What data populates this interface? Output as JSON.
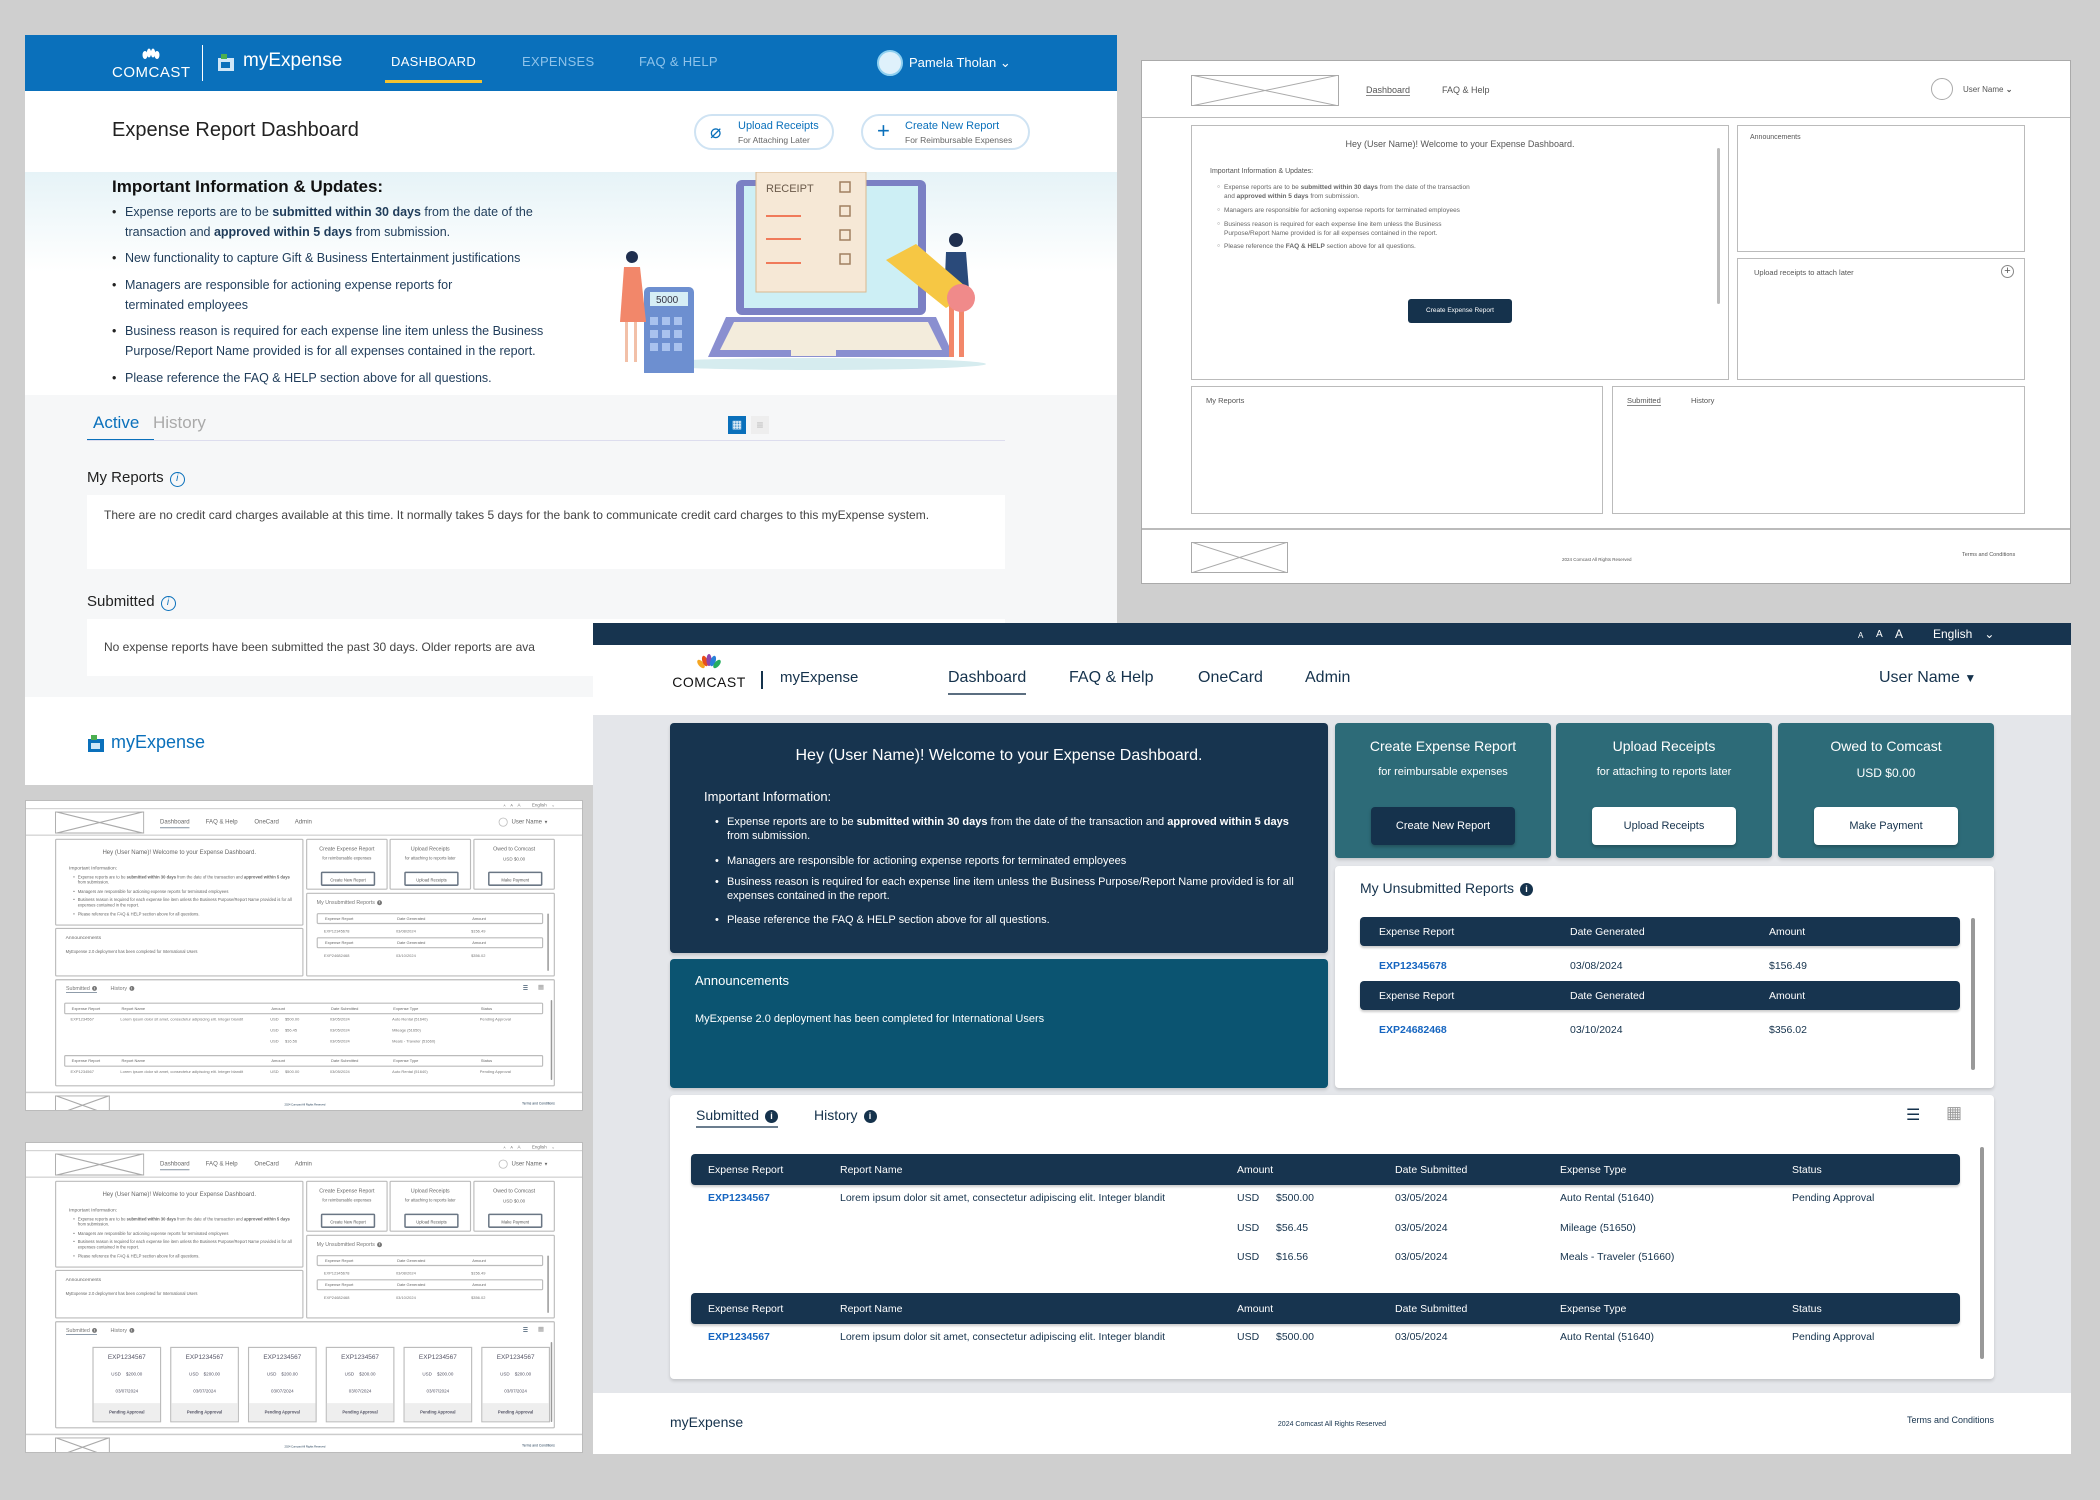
{
  "v1": {
    "header": {
      "brand": "COMCAST",
      "app": "myExpense",
      "nav": [
        "DASHBOARD",
        "EXPENSES",
        "FAQ & HELP"
      ],
      "user": "Pamela Tholan"
    },
    "title": "Expense Report Dashboard",
    "actions": [
      {
        "label": "Upload Receipts",
        "sub": "For Attaching Later"
      },
      {
        "label": "Create New Report",
        "sub": "For Reimbursable Expenses"
      }
    ],
    "info": {
      "heading": "Important Information & Updates:",
      "items": [
        [
          "Expense reports are to be ",
          "submitted within 30 days",
          " from the date of the transaction and ",
          "approved within 5 days",
          " from submission."
        ],
        [
          "New functionality to capture Gift & Business Entertainment justifications"
        ],
        [
          "Managers are responsible for actioning expense reports for terminated employees"
        ],
        [
          "Business reason is required for each expense line item unless the Business Purpose/Report Name provided is for all expenses contained in the report."
        ],
        [
          "Please reference the FAQ & HELP section above for all questions."
        ]
      ]
    },
    "illustration": {
      "receipt_label": "RECEIPT",
      "calc_display": "5000"
    },
    "tabs": [
      "Active",
      "History"
    ],
    "my_reports": {
      "title": "My Reports",
      "message": "There are no credit card charges available at this time. It normally takes 5 days for the bank to communicate credit card charges to this myExpense system."
    },
    "submitted": {
      "title": "Submitted",
      "message": "No expense reports have been submitted the past 30 days. Older reports are ava"
    },
    "footer_app": "myExpense"
  },
  "wireframe_v1": {
    "nav": [
      "Dashboard",
      "FAQ & Help"
    ],
    "user": "User Name",
    "welcome": "Hey (User Name)!  Welcome to your Expense Dashboard.",
    "info_heading": "Important Information & Updates:",
    "items": [
      [
        "Expense reports are to be ",
        "submitted within 30 days",
        " from the date of the transaction and ",
        "approved within 5 days",
        " from submission."
      ],
      [
        "Managers are responsible for actioning expense reports for terminated employees"
      ],
      [
        "Business reason is required for each expense line item unless the Business Purpose/Report Name provided is for all expenses contained in the report."
      ],
      [
        "Please reference the ",
        "FAQ & HELP",
        " section above for all questions."
      ]
    ],
    "button": "Create Expense Report",
    "announcements": "Announcements",
    "upload": "Upload receipts to attach later",
    "my_reports": "My Reports",
    "tabs": [
      "Submitted",
      "History"
    ],
    "copyright": "2024 Comcast All Rights Reserved",
    "terms": "Terms and Conditions"
  },
  "v2": {
    "top_bar": {
      "font_sizes": [
        "A",
        "A",
        "A"
      ],
      "language": "English"
    },
    "header": {
      "brand": "COMCAST",
      "app": "myExpense",
      "nav": [
        "Dashboard",
        "FAQ & Help",
        "OneCard",
        "Admin"
      ],
      "user": "User Name"
    },
    "welcome": {
      "title": "Hey (User Name)!  Welcome to your Expense Dashboard.",
      "info_heading": "Important Information:",
      "items": [
        [
          "Expense reports are to be ",
          "submitted within 30 days",
          " from the date of the transaction and ",
          "approved within 5 days",
          " from submission."
        ],
        [
          "Managers are responsible for actioning expense reports for terminated employees"
        ],
        [
          "Business reason is required for each expense line item unless the Business Purpose/Report Name provided is for all expenses contained in the report."
        ],
        [
          "Please reference the FAQ & HELP section above for all questions."
        ]
      ]
    },
    "tiles": [
      {
        "title": "Create Expense Report",
        "sub": "for reimbursable expenses",
        "button": "Create New Report"
      },
      {
        "title": "Upload Receipts",
        "sub": "for attaching to reports later",
        "button": "Upload Receipts"
      },
      {
        "title": "Owed to Comcast",
        "sub": "USD $0.00",
        "button": "Make Payment"
      }
    ],
    "announcements": {
      "title": "Announcements",
      "message": "MyExpense 2.0 deployment has been completed for International Users"
    },
    "unsubmitted": {
      "title": "My Unsubmitted Reports",
      "columns": [
        "Expense Report",
        "Date Generated",
        "Amount"
      ],
      "rows": [
        [
          "EXP12345678",
          "03/08/2024",
          "$156.49"
        ],
        [
          "EXP24682468",
          "03/10/2024",
          "$356.02"
        ]
      ]
    },
    "submitted": {
      "tabs": [
        "Submitted",
        "History"
      ],
      "columns": [
        "Expense Report",
        "Report Name",
        "Amount",
        "Date Submitted",
        "Expense Type",
        "Status"
      ],
      "groups": [
        {
          "report": "EXP1234567",
          "name": "Lorem ipsum dolor sit amet, consectetur adipiscing elit. Integer blandit",
          "status": "Pending Approval",
          "lines": [
            {
              "currency": "USD",
              "amount": "$500.00",
              "date": "03/05/2024",
              "type": "Auto Rental (51640)"
            },
            {
              "currency": "USD",
              "amount": "$56.45",
              "date": "03/05/2024",
              "type": "Mileage (51650)"
            },
            {
              "currency": "USD",
              "amount": "$16.56",
              "date": "03/05/2024",
              "type": "Meals - Traveler (51660)"
            }
          ]
        },
        {
          "report": "EXP1234567",
          "name": "Lorem ipsum dolor sit amet, consectetur adipiscing elit. Integer blandit",
          "status": "Pending Approval",
          "lines": [
            {
              "currency": "USD",
              "amount": "$500.00",
              "date": "03/05/2024",
              "type": "Auto Rental (51640)"
            }
          ]
        }
      ]
    },
    "footer": {
      "app": "myExpense",
      "copyright": "2024 Comcast All Rights Reserved",
      "terms": "Terms and Conditions"
    }
  },
  "wireframe_grid": {
    "card": {
      "report": "EXP1234567",
      "currency": "USD",
      "amount": "$200.00",
      "date": "03/07/2024",
      "status": "Pending Approval"
    }
  },
  "colors": {
    "v1_brand": "#0a70bb",
    "v2_navy": "#17344f",
    "v2_teal": "#2d6b78",
    "v2_announce": "#0b5471",
    "link": "#1565c0"
  }
}
